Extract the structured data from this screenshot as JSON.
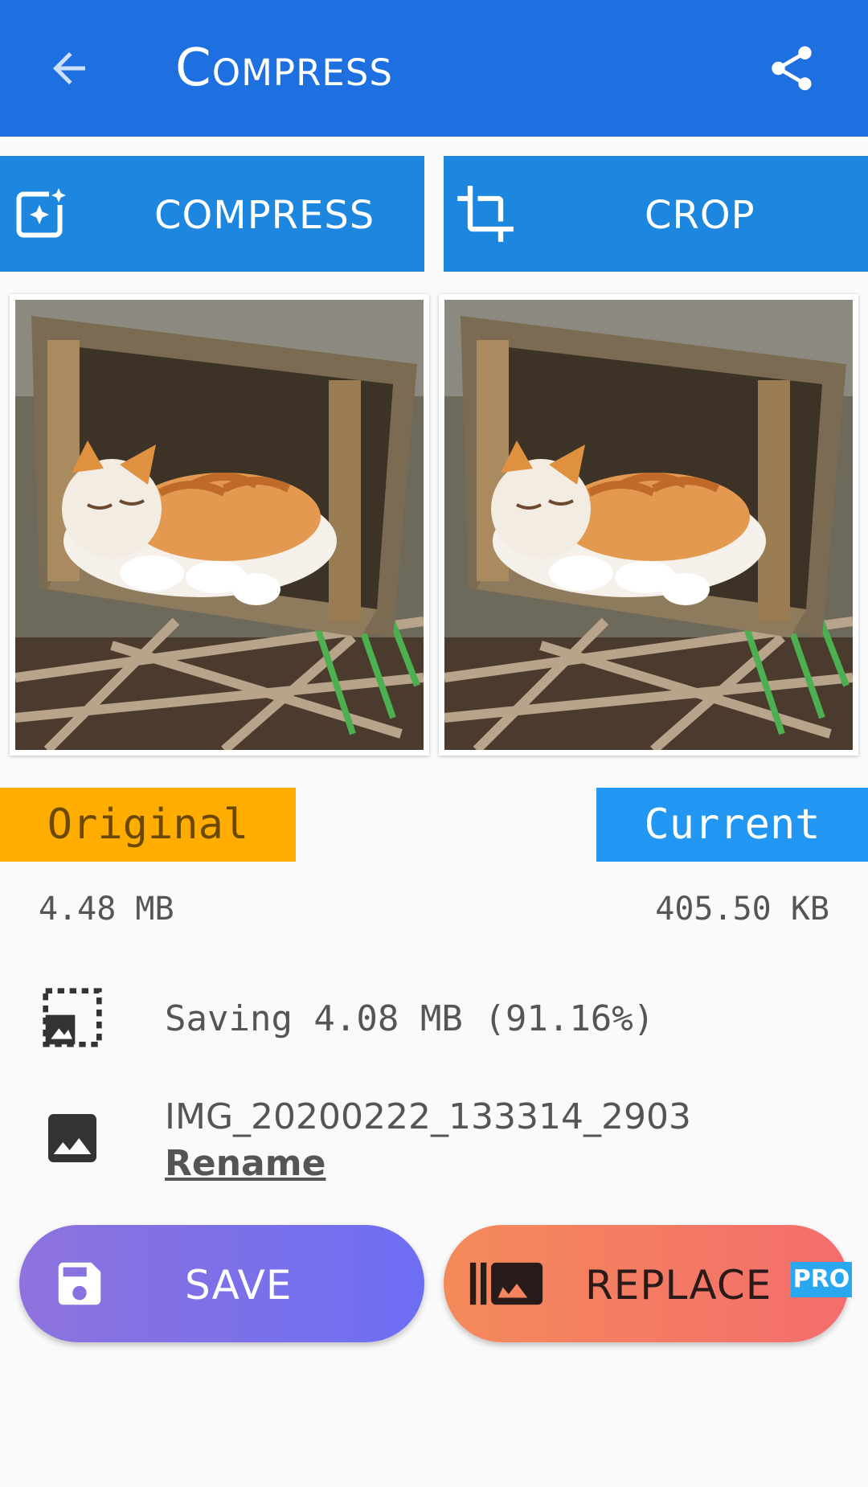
{
  "appbar": {
    "title": "Compress"
  },
  "toolbar": {
    "compress_label": "COMPRESS",
    "crop_label": "CROP"
  },
  "labels": {
    "original": "Original",
    "current": "Current"
  },
  "sizes": {
    "original": "4.48 MB",
    "current": "405.50 KB"
  },
  "saving": {
    "text": "Saving 4.08 MB (91.16%)"
  },
  "file": {
    "name": "IMG_20200222_133314_2903",
    "rename": "Rename"
  },
  "actions": {
    "save": "SAVE",
    "replace": "REPLACE",
    "pro_badge": "PRO"
  },
  "colors": {
    "appbar": "#1e6fe0",
    "tab_button": "#1d86df",
    "original_tag": "#ffad00",
    "current_tag": "#2196f3"
  },
  "icons": [
    "back-arrow-icon",
    "share-icon",
    "compress-sparkle-icon",
    "crop-icon",
    "image-resize-icon",
    "image-icon",
    "save-icon",
    "replace-image-icon"
  ]
}
